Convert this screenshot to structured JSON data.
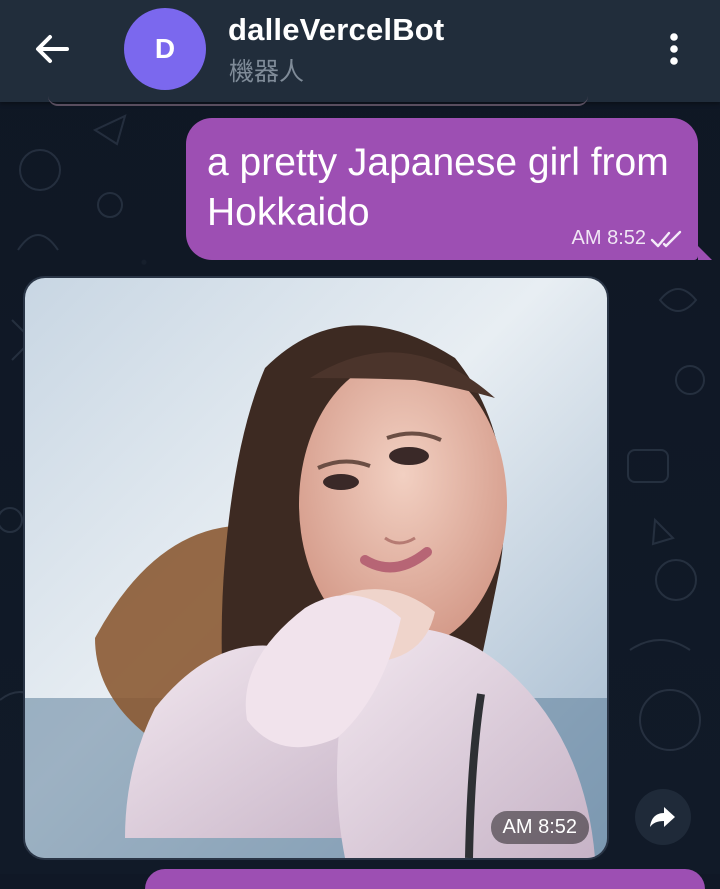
{
  "header": {
    "title": "dalleVercelBot",
    "subtitle": "機器人",
    "avatar_letter": "D",
    "back_icon": "arrow-left-icon",
    "more_icon": "more-vertical-icon"
  },
  "messages": [
    {
      "type": "outgoing-text",
      "text": "a pretty Japanese girl from Hokkaido",
      "time": "AM 8:52",
      "status_icon": "double-check-icon"
    },
    {
      "type": "incoming-photo",
      "time": "AM 8:52",
      "share_icon": "forward-share-icon"
    }
  ],
  "colors": {
    "header_bg": "#212d3b",
    "chat_bg": "#101826",
    "outgoing_bubble": "#9d4fb3",
    "avatar": "#7b68ee"
  }
}
